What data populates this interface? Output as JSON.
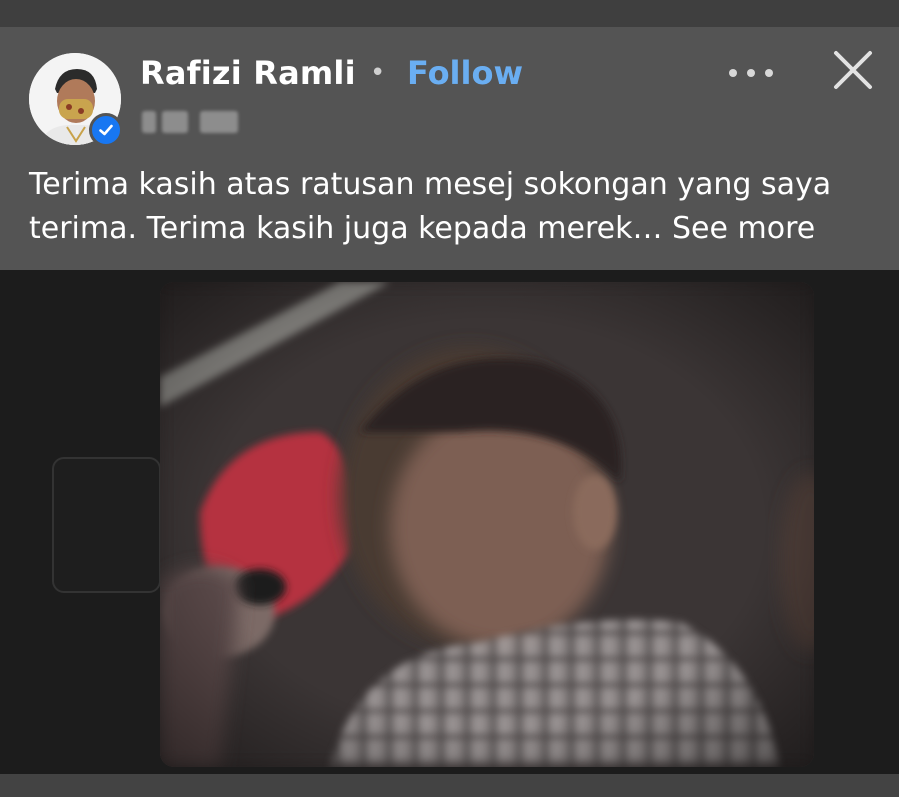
{
  "post": {
    "author_name": "Rafizi Ramli",
    "separator": "•",
    "follow_label": "Follow",
    "verified": true,
    "text": "Terima kasih atas ratusan mesej sokongan yang saya terima. Terima kasih juga kepada merek…",
    "see_more_label": "See more"
  },
  "icons": {
    "more": "more-horizontal-icon",
    "close": "close-icon",
    "verified": "verified-badge-icon"
  },
  "colors": {
    "header_bg": "#545454",
    "follow_link": "#6aaef2",
    "verified_badge": "#1877f2",
    "video_bg": "#1c1c1c"
  }
}
